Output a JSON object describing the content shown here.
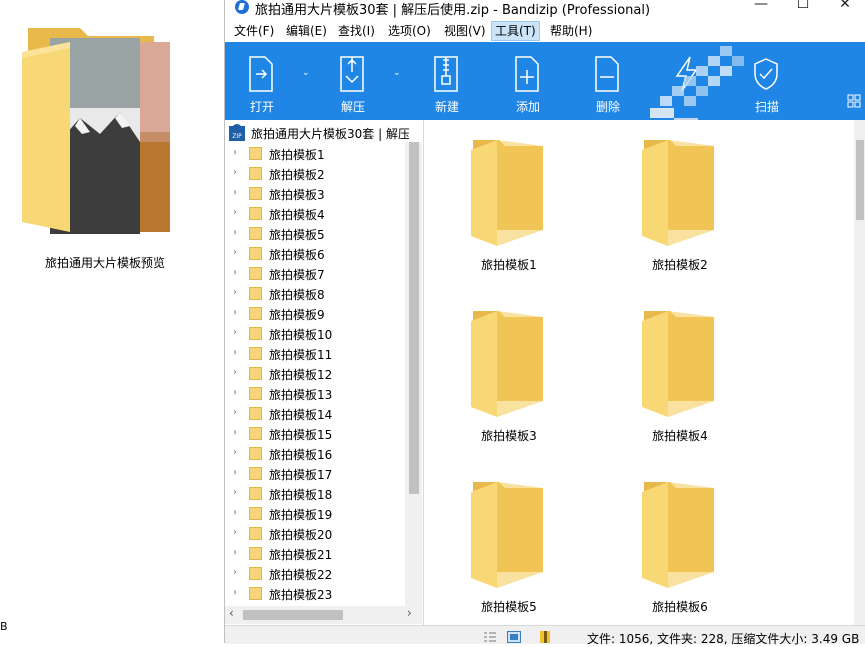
{
  "desktop": {
    "folder_label": "旅拍通用大片模板预览",
    "edge_text": "B"
  },
  "window": {
    "title": "旅拍通用大片模板30套 | 解压后使用.zip - Bandizip (Professional)",
    "minimize": "—",
    "maximize": "☐",
    "close": "✕"
  },
  "menu": [
    {
      "label": "文件(F)"
    },
    {
      "label": "编辑(E)"
    },
    {
      "label": "查找(I)"
    },
    {
      "label": "选项(O)"
    },
    {
      "label": "视图(V)"
    },
    {
      "label": "工具(T)"
    },
    {
      "label": "帮助(H)"
    }
  ],
  "toolbar": {
    "open": "打开",
    "extract": "解压",
    "new": "新建",
    "add": "添加",
    "delete": "删除",
    "scan": "扫描",
    "dropdown": "⌄"
  },
  "tree": {
    "root": "旅拍通用大片模板30套 | 解压后使用",
    "items": [
      "旅拍模板1",
      "旅拍模板2",
      "旅拍模板3",
      "旅拍模板4",
      "旅拍模板5",
      "旅拍模板6",
      "旅拍模板7",
      "旅拍模板8",
      "旅拍模板9",
      "旅拍模板10",
      "旅拍模板11",
      "旅拍模板12",
      "旅拍模板13",
      "旅拍模板14",
      "旅拍模板15",
      "旅拍模板16",
      "旅拍模板17",
      "旅拍模板18",
      "旅拍模板19",
      "旅拍模板20",
      "旅拍模板21",
      "旅拍模板22",
      "旅拍模板23"
    ],
    "chevron": "›",
    "scroll_left": "‹",
    "scroll_right": "›"
  },
  "content": {
    "folders": [
      "旅拍模板1",
      "旅拍模板2",
      "旅拍模板3",
      "旅拍模板4",
      "旅拍模板5",
      "旅拍模板6"
    ]
  },
  "status": {
    "text": "文件: 1056, 文件夹: 228, 压缩文件大小: 3.49 GB"
  },
  "colors": {
    "toolbar_bg": "#1f86e6",
    "folder_yellow": "#f8d775",
    "folder_dark": "#e8b84a"
  }
}
